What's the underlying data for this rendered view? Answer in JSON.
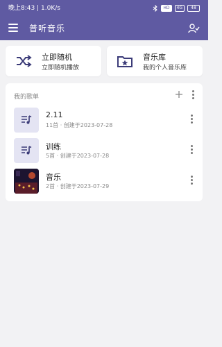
{
  "status_bar": {
    "time": "晚上8:43",
    "speed": "1.0K/s",
    "bluetooth_icon": "bluetooth-icon",
    "hd_label": "HD",
    "signal_label": "4G",
    "battery_label": "48"
  },
  "header": {
    "title": "普听音乐",
    "menu_icon": "menu-icon",
    "action_icon": "recognize-icon",
    "background_color": "#5f5aa2"
  },
  "quick_actions": [
    {
      "title": "立即随机",
      "subtitle": "立即随机播放",
      "icon": "shuffle-icon"
    },
    {
      "title": "音乐库",
      "subtitle": "我的个人音乐库",
      "icon": "library-icon"
    }
  ],
  "playlists": {
    "section_label": "我的歌单",
    "add_icon": "add-icon",
    "items": [
      {
        "title": "2.11",
        "meta": "11首 · 创建于2023-07-28",
        "thumb": "playlist-icon"
      },
      {
        "title": "训练",
        "meta": "5首 · 创建于2023-07-28",
        "thumb": "playlist-icon"
      },
      {
        "title": "音乐",
        "meta": "2首 · 创建于2023-07-29",
        "thumb": "cover-image"
      }
    ]
  }
}
